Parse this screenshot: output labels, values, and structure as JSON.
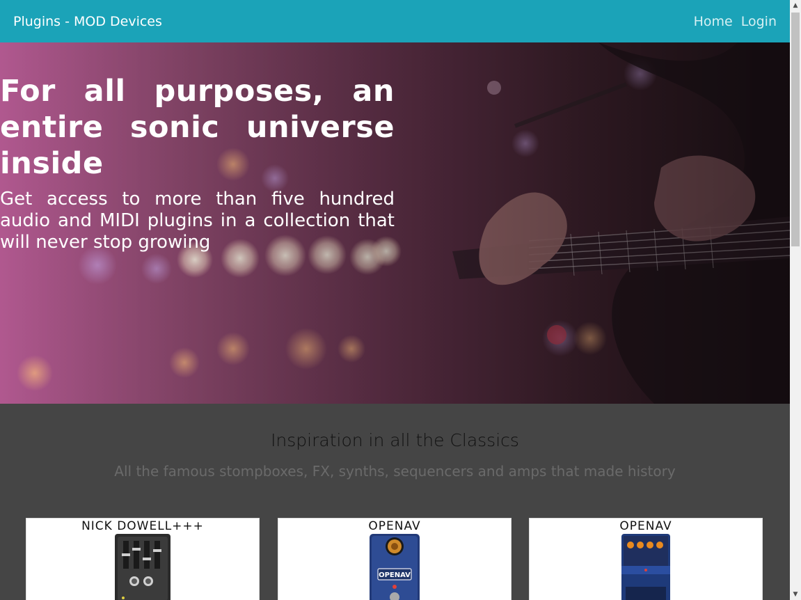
{
  "navbar": {
    "brand": "Plugins - MOD Devices",
    "links": [
      "Home",
      "Login"
    ]
  },
  "hero": {
    "title_lines": [
      "For all purposes, an",
      "entire sonic universe",
      "inside"
    ],
    "subtitle": "Get access to more than five hundred audio and MIDI plugins in a collection that will never stop growing"
  },
  "section": {
    "title": "Inspiration in all the Classics",
    "subtitle": "All the famous stompboxes, FX, synths, sequencers and amps that made history"
  },
  "cards": [
    {
      "brand": "NICK DOWELL+++"
    },
    {
      "brand": "OPENAV"
    },
    {
      "brand": "OPENAV"
    }
  ],
  "pedals": {
    "openav_label": "OPENAV"
  },
  "colors": {
    "navbar": "#1ba3b8",
    "body": "#454545"
  }
}
